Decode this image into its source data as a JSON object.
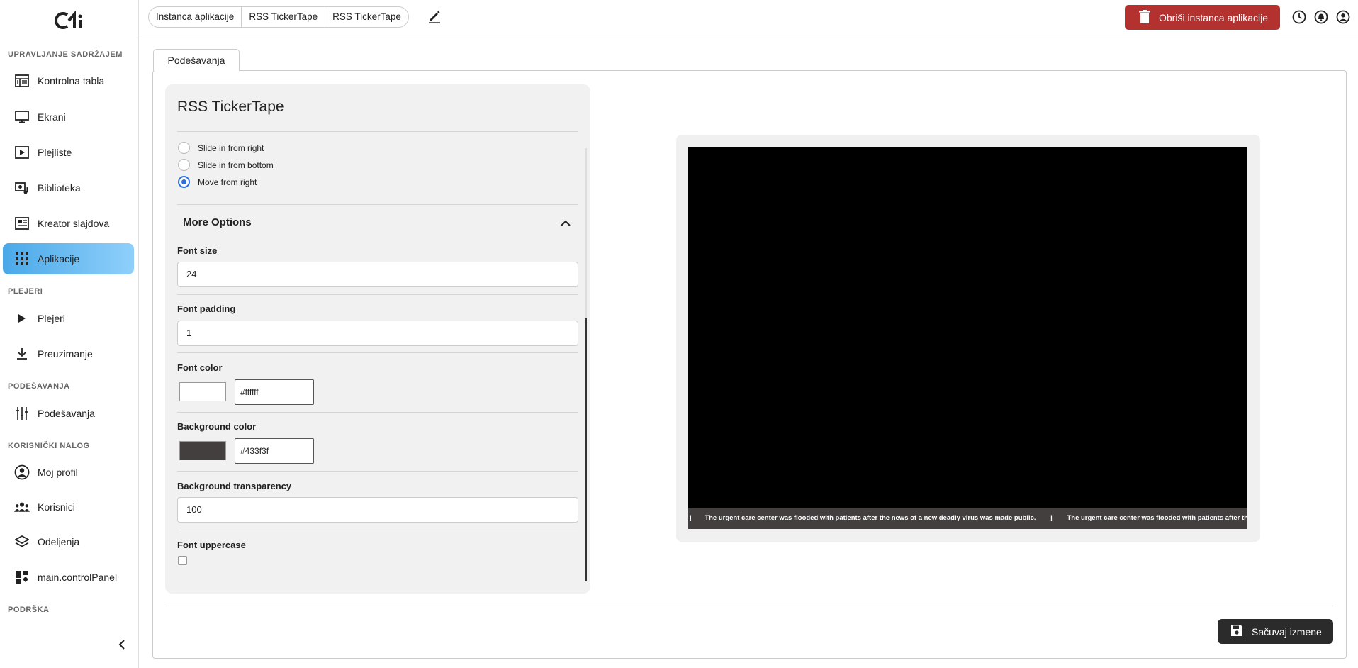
{
  "sidebar": {
    "logo": "ci",
    "sections": {
      "content": "UPRAVLJANJE SADRŽAJEM",
      "players": "PLEJERI",
      "settings": "PODEŠAVANJA",
      "account": "KORISNIČKI NALOG",
      "support": "PODRŠKA"
    },
    "items": [
      {
        "label": "Kontrolna tabla",
        "icon": "dashboard-icon"
      },
      {
        "label": "Ekrani",
        "icon": "monitor-icon"
      },
      {
        "label": "Plejliste",
        "icon": "playlist-icon"
      },
      {
        "label": "Biblioteka",
        "icon": "library-icon"
      },
      {
        "label": "Kreator slajdova",
        "icon": "slide-creator-icon"
      },
      {
        "label": "Aplikacije",
        "icon": "apps-grid-icon"
      },
      {
        "label": "Plejeri",
        "icon": "play-icon"
      },
      {
        "label": "Preuzimanje",
        "icon": "download-icon"
      },
      {
        "label": "Podešavanja",
        "icon": "sliders-icon"
      },
      {
        "label": "Moj profil",
        "icon": "profile-icon"
      },
      {
        "label": "Korisnici",
        "icon": "users-icon"
      },
      {
        "label": "Odeljenja",
        "icon": "layers-icon"
      },
      {
        "label": "main.controlPanel",
        "icon": "control-panel-icon"
      }
    ],
    "active_item": "Aplikacije"
  },
  "topbar": {
    "breadcrumbs": [
      "Instanca aplikacije",
      "RSS TickerTape",
      "RSS TickerTape"
    ],
    "delete_label": "Obriši instanca aplikacije"
  },
  "tab": {
    "label": "Podešavanja"
  },
  "form": {
    "title": "RSS TickerTape",
    "animation_options": [
      "Slide in from right",
      "Slide in from bottom",
      "Move from right"
    ],
    "selected_animation": "Move from right",
    "more_options_title": "More Options",
    "font_size": {
      "label": "Font size",
      "value": "24"
    },
    "font_padding": {
      "label": "Font padding",
      "value": "1"
    },
    "font_color": {
      "label": "Font color",
      "value": "#ffffff",
      "swatch": "#ffffff"
    },
    "background_color": {
      "label": "Background color",
      "value": "#433f3f",
      "swatch": "#433f3f"
    },
    "background_transparency": {
      "label": "Background transparency",
      "value": "100"
    },
    "font_uppercase": {
      "label": "Font uppercase",
      "checked": false
    }
  },
  "preview": {
    "ticker_separator": "|",
    "ticker_text": "The urgent care center was flooded with patients after the news of a new deadly virus was made public."
  },
  "footer": {
    "save_label": "Sačuvaj izmene"
  },
  "colors": {
    "accent": "#4aa8e8",
    "danger": "#b3312f",
    "dark_button": "#2b2b2b",
    "radio": "#2b6fe0"
  }
}
